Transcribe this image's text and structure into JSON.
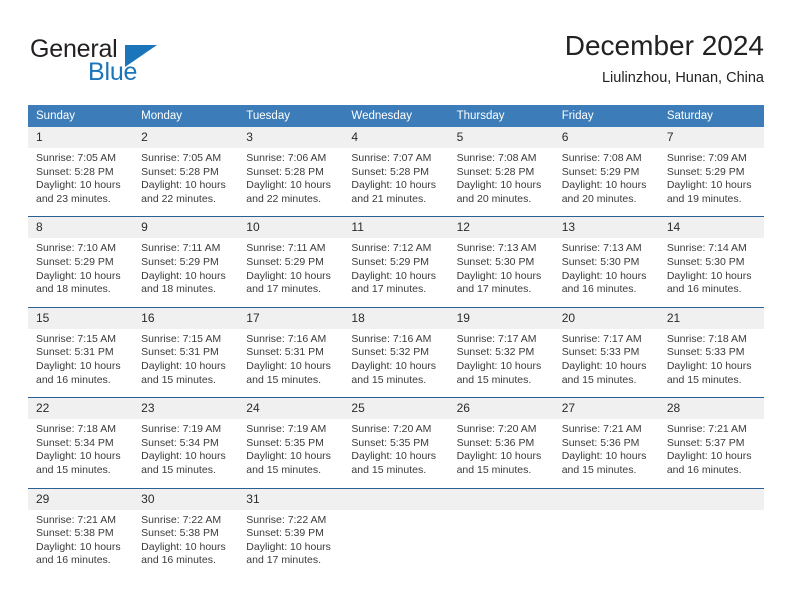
{
  "logo": {
    "word1": "General",
    "word2": "Blue",
    "triangle_color": "#1b75bb",
    "text_color": "#231f20"
  },
  "header": {
    "title": "December 2024",
    "subtitle": "Liulinzhou, Hunan, China"
  },
  "theme": {
    "header_bg": "#3c7cb8",
    "row_divider": "#2a6096",
    "daynum_bg": "#f0f0f0",
    "text": "#3b3b3b"
  },
  "weekday_headers": [
    "Sunday",
    "Monday",
    "Tuesday",
    "Wednesday",
    "Thursday",
    "Friday",
    "Saturday"
  ],
  "weeks": [
    [
      {
        "day": "1",
        "sunrise": "Sunrise: 7:05 AM",
        "sunset": "Sunset: 5:28 PM",
        "daylight1": "Daylight: 10 hours",
        "daylight2": "and 23 minutes."
      },
      {
        "day": "2",
        "sunrise": "Sunrise: 7:05 AM",
        "sunset": "Sunset: 5:28 PM",
        "daylight1": "Daylight: 10 hours",
        "daylight2": "and 22 minutes."
      },
      {
        "day": "3",
        "sunrise": "Sunrise: 7:06 AM",
        "sunset": "Sunset: 5:28 PM",
        "daylight1": "Daylight: 10 hours",
        "daylight2": "and 22 minutes."
      },
      {
        "day": "4",
        "sunrise": "Sunrise: 7:07 AM",
        "sunset": "Sunset: 5:28 PM",
        "daylight1": "Daylight: 10 hours",
        "daylight2": "and 21 minutes."
      },
      {
        "day": "5",
        "sunrise": "Sunrise: 7:08 AM",
        "sunset": "Sunset: 5:28 PM",
        "daylight1": "Daylight: 10 hours",
        "daylight2": "and 20 minutes."
      },
      {
        "day": "6",
        "sunrise": "Sunrise: 7:08 AM",
        "sunset": "Sunset: 5:29 PM",
        "daylight1": "Daylight: 10 hours",
        "daylight2": "and 20 minutes."
      },
      {
        "day": "7",
        "sunrise": "Sunrise: 7:09 AM",
        "sunset": "Sunset: 5:29 PM",
        "daylight1": "Daylight: 10 hours",
        "daylight2": "and 19 minutes."
      }
    ],
    [
      {
        "day": "8",
        "sunrise": "Sunrise: 7:10 AM",
        "sunset": "Sunset: 5:29 PM",
        "daylight1": "Daylight: 10 hours",
        "daylight2": "and 18 minutes."
      },
      {
        "day": "9",
        "sunrise": "Sunrise: 7:11 AM",
        "sunset": "Sunset: 5:29 PM",
        "daylight1": "Daylight: 10 hours",
        "daylight2": "and 18 minutes."
      },
      {
        "day": "10",
        "sunrise": "Sunrise: 7:11 AM",
        "sunset": "Sunset: 5:29 PM",
        "daylight1": "Daylight: 10 hours",
        "daylight2": "and 17 minutes."
      },
      {
        "day": "11",
        "sunrise": "Sunrise: 7:12 AM",
        "sunset": "Sunset: 5:29 PM",
        "daylight1": "Daylight: 10 hours",
        "daylight2": "and 17 minutes."
      },
      {
        "day": "12",
        "sunrise": "Sunrise: 7:13 AM",
        "sunset": "Sunset: 5:30 PM",
        "daylight1": "Daylight: 10 hours",
        "daylight2": "and 17 minutes."
      },
      {
        "day": "13",
        "sunrise": "Sunrise: 7:13 AM",
        "sunset": "Sunset: 5:30 PM",
        "daylight1": "Daylight: 10 hours",
        "daylight2": "and 16 minutes."
      },
      {
        "day": "14",
        "sunrise": "Sunrise: 7:14 AM",
        "sunset": "Sunset: 5:30 PM",
        "daylight1": "Daylight: 10 hours",
        "daylight2": "and 16 minutes."
      }
    ],
    [
      {
        "day": "15",
        "sunrise": "Sunrise: 7:15 AM",
        "sunset": "Sunset: 5:31 PM",
        "daylight1": "Daylight: 10 hours",
        "daylight2": "and 16 minutes."
      },
      {
        "day": "16",
        "sunrise": "Sunrise: 7:15 AM",
        "sunset": "Sunset: 5:31 PM",
        "daylight1": "Daylight: 10 hours",
        "daylight2": "and 15 minutes."
      },
      {
        "day": "17",
        "sunrise": "Sunrise: 7:16 AM",
        "sunset": "Sunset: 5:31 PM",
        "daylight1": "Daylight: 10 hours",
        "daylight2": "and 15 minutes."
      },
      {
        "day": "18",
        "sunrise": "Sunrise: 7:16 AM",
        "sunset": "Sunset: 5:32 PM",
        "daylight1": "Daylight: 10 hours",
        "daylight2": "and 15 minutes."
      },
      {
        "day": "19",
        "sunrise": "Sunrise: 7:17 AM",
        "sunset": "Sunset: 5:32 PM",
        "daylight1": "Daylight: 10 hours",
        "daylight2": "and 15 minutes."
      },
      {
        "day": "20",
        "sunrise": "Sunrise: 7:17 AM",
        "sunset": "Sunset: 5:33 PM",
        "daylight1": "Daylight: 10 hours",
        "daylight2": "and 15 minutes."
      },
      {
        "day": "21",
        "sunrise": "Sunrise: 7:18 AM",
        "sunset": "Sunset: 5:33 PM",
        "daylight1": "Daylight: 10 hours",
        "daylight2": "and 15 minutes."
      }
    ],
    [
      {
        "day": "22",
        "sunrise": "Sunrise: 7:18 AM",
        "sunset": "Sunset: 5:34 PM",
        "daylight1": "Daylight: 10 hours",
        "daylight2": "and 15 minutes."
      },
      {
        "day": "23",
        "sunrise": "Sunrise: 7:19 AM",
        "sunset": "Sunset: 5:34 PM",
        "daylight1": "Daylight: 10 hours",
        "daylight2": "and 15 minutes."
      },
      {
        "day": "24",
        "sunrise": "Sunrise: 7:19 AM",
        "sunset": "Sunset: 5:35 PM",
        "daylight1": "Daylight: 10 hours",
        "daylight2": "and 15 minutes."
      },
      {
        "day": "25",
        "sunrise": "Sunrise: 7:20 AM",
        "sunset": "Sunset: 5:35 PM",
        "daylight1": "Daylight: 10 hours",
        "daylight2": "and 15 minutes."
      },
      {
        "day": "26",
        "sunrise": "Sunrise: 7:20 AM",
        "sunset": "Sunset: 5:36 PM",
        "daylight1": "Daylight: 10 hours",
        "daylight2": "and 15 minutes."
      },
      {
        "day": "27",
        "sunrise": "Sunrise: 7:21 AM",
        "sunset": "Sunset: 5:36 PM",
        "daylight1": "Daylight: 10 hours",
        "daylight2": "and 15 minutes."
      },
      {
        "day": "28",
        "sunrise": "Sunrise: 7:21 AM",
        "sunset": "Sunset: 5:37 PM",
        "daylight1": "Daylight: 10 hours",
        "daylight2": "and 16 minutes."
      }
    ],
    [
      {
        "day": "29",
        "sunrise": "Sunrise: 7:21 AM",
        "sunset": "Sunset: 5:38 PM",
        "daylight1": "Daylight: 10 hours",
        "daylight2": "and 16 minutes."
      },
      {
        "day": "30",
        "sunrise": "Sunrise: 7:22 AM",
        "sunset": "Sunset: 5:38 PM",
        "daylight1": "Daylight: 10 hours",
        "daylight2": "and 16 minutes."
      },
      {
        "day": "31",
        "sunrise": "Sunrise: 7:22 AM",
        "sunset": "Sunset: 5:39 PM",
        "daylight1": "Daylight: 10 hours",
        "daylight2": "and 17 minutes."
      },
      {
        "day": "",
        "sunrise": "",
        "sunset": "",
        "daylight1": "",
        "daylight2": ""
      },
      {
        "day": "",
        "sunrise": "",
        "sunset": "",
        "daylight1": "",
        "daylight2": ""
      },
      {
        "day": "",
        "sunrise": "",
        "sunset": "",
        "daylight1": "",
        "daylight2": ""
      },
      {
        "day": "",
        "sunrise": "",
        "sunset": "",
        "daylight1": "",
        "daylight2": ""
      }
    ]
  ]
}
